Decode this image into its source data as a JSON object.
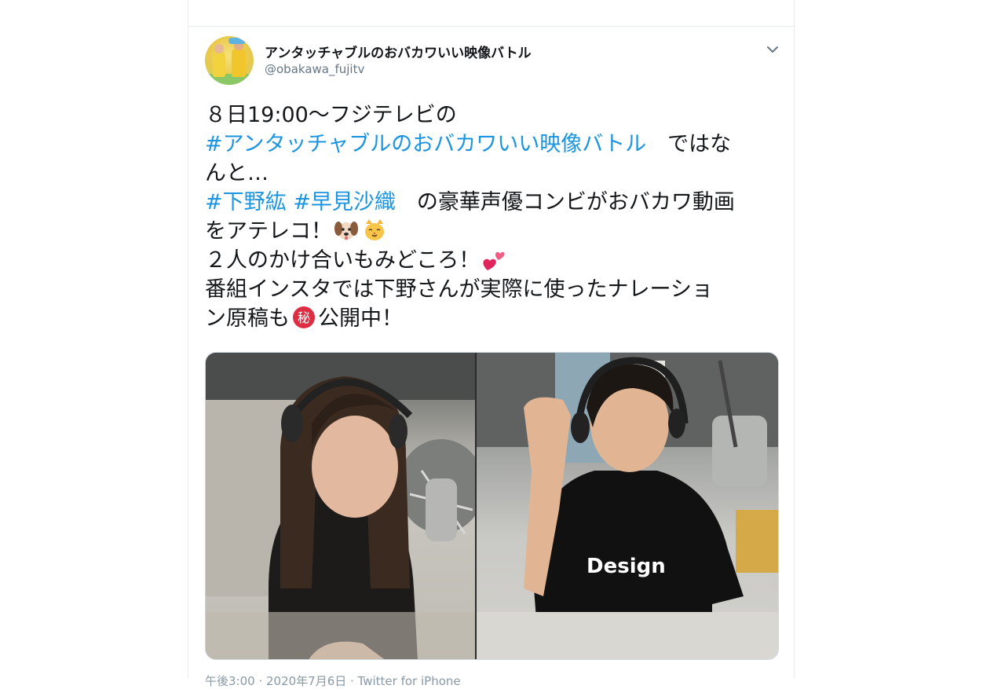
{
  "tweet": {
    "display_name": "アンタッチャブルのおバカワいい映像バトル",
    "handle": "@obakawa_fujitv",
    "avatar_icon": "profile-photo-avatar",
    "menu_icon": "chevron-down-icon",
    "text": {
      "line1": "８日19:00〜フジテレビの",
      "hashtag_show": "#アンタッチャブルのおバカワいい映像バトル",
      "line2_tail": "　ではな",
      "line3": "んと…",
      "hashtag_va1": "#下野紘",
      "hashtag_va2": "#早見沙織",
      "line4_tail": "　の豪華声優コンビがおバカワ動画",
      "line5": "をアテレコ！",
      "line6": "２人のかけ合いもみどころ！",
      "line7": "番組インスタでは下野さんが実際に使ったナレーショ",
      "line8_head": "ン原稿も",
      "line8_tail": "公開中！"
    },
    "emoji_names": [
      "dog-face-emoji",
      "cat-face-emoji",
      "two-hearts-emoji",
      "circled-secret-emoji"
    ],
    "footer_time": "午後3:00 · 2020年7月6日 · Twitter for iPhone"
  },
  "colors": {
    "hashtag": "#1b95e0",
    "text": "#14171a",
    "secondary": "#657786",
    "border": "#e6ecf0"
  }
}
